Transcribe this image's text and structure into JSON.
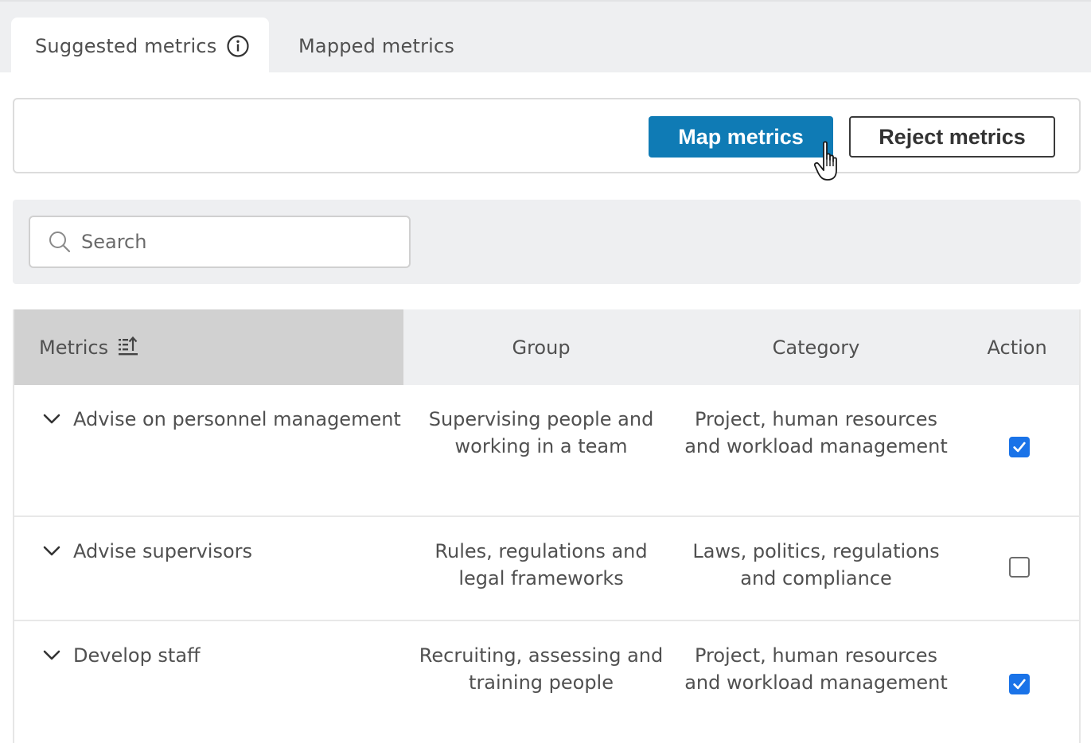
{
  "tabs": [
    {
      "label": "Suggested metrics",
      "active": true,
      "icon": "info-icon"
    },
    {
      "label": "Mapped metrics",
      "active": false
    }
  ],
  "actions": {
    "map_label": "Map metrics",
    "reject_label": "Reject metrics",
    "primary_color": "#0f7bb5"
  },
  "search": {
    "placeholder": "Search",
    "value": ""
  },
  "table": {
    "columns": {
      "metrics": "Metrics",
      "group": "Group",
      "category": "Category",
      "action": "Action"
    },
    "sort_icon": "sort-ascending-icon",
    "rows": [
      {
        "metric": "Advise on personnel management",
        "group": "Supervising people and working in a team",
        "category": "Project, human resources and workload management",
        "checked": true
      },
      {
        "metric": "Advise supervisors",
        "group": "Rules, regulations and legal frameworks",
        "category": "Laws, politics, regulations and compliance",
        "checked": false
      },
      {
        "metric": "Develop staff",
        "group": "Recruiting, assessing and training people",
        "category": "Project, human resources and workload management",
        "checked": true
      }
    ]
  }
}
